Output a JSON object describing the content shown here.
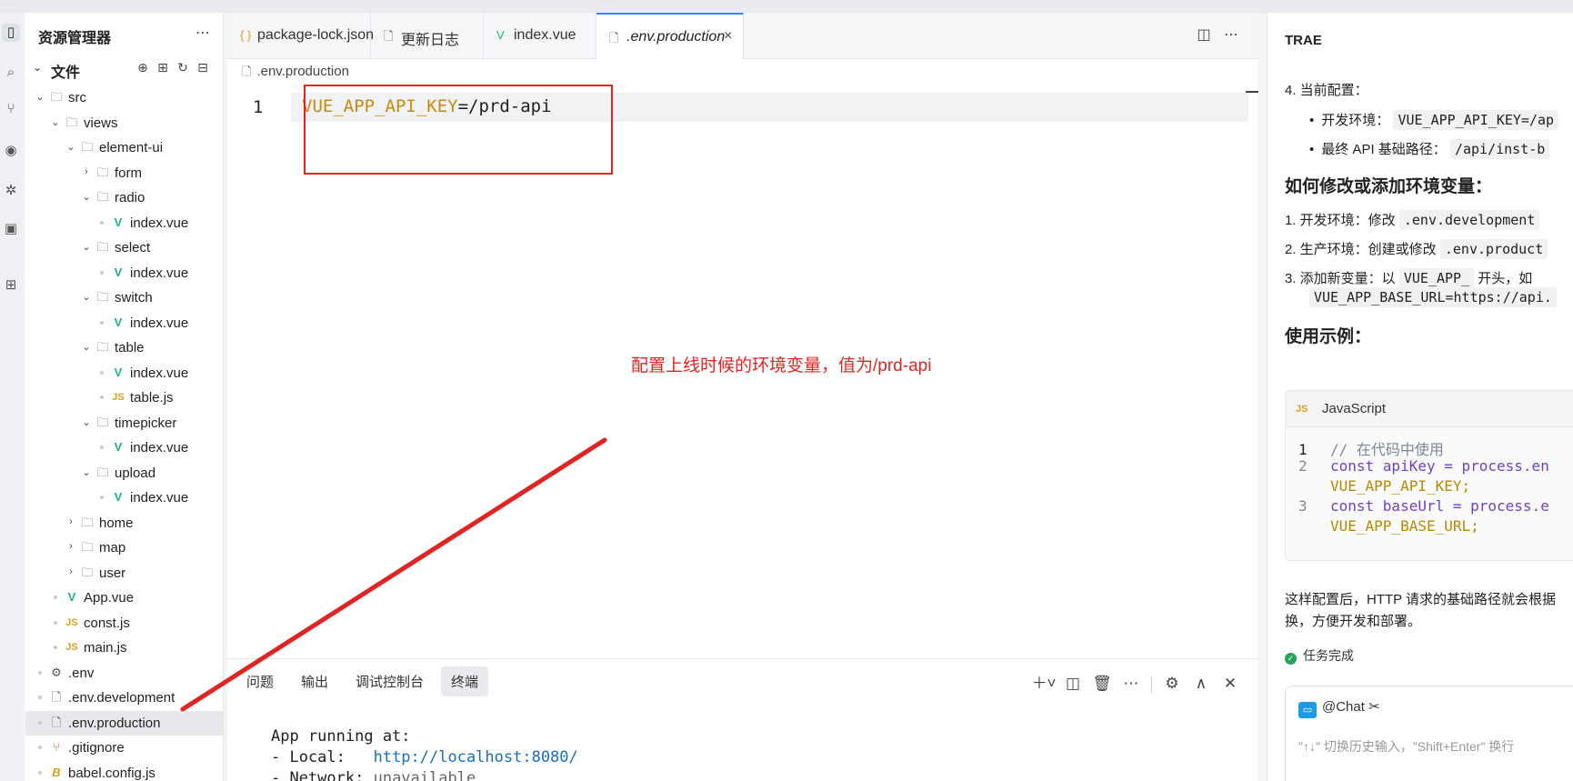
{
  "sidebar": {
    "title": "资源管理器",
    "section_label": "文件",
    "tree": [
      {
        "label": "src",
        "kind": "folder",
        "depth": 0,
        "expanded": true
      },
      {
        "label": "views",
        "kind": "folder",
        "depth": 1,
        "expanded": true
      },
      {
        "label": "element-ui",
        "kind": "folder",
        "depth": 2,
        "expanded": true
      },
      {
        "label": "form",
        "kind": "folder",
        "depth": 3,
        "expanded": false
      },
      {
        "label": "radio",
        "kind": "folder",
        "depth": 3,
        "expanded": true
      },
      {
        "label": "index.vue",
        "kind": "vue",
        "depth": 4
      },
      {
        "label": "select",
        "kind": "folder",
        "depth": 3,
        "expanded": true
      },
      {
        "label": "index.vue",
        "kind": "vue",
        "depth": 4
      },
      {
        "label": "switch",
        "kind": "folder",
        "depth": 3,
        "expanded": true
      },
      {
        "label": "index.vue",
        "kind": "vue",
        "depth": 4
      },
      {
        "label": "table",
        "kind": "folder",
        "depth": 3,
        "expanded": true
      },
      {
        "label": "index.vue",
        "kind": "vue",
        "depth": 4
      },
      {
        "label": "table.js",
        "kind": "js",
        "depth": 4
      },
      {
        "label": "timepicker",
        "kind": "folder",
        "depth": 3,
        "expanded": true
      },
      {
        "label": "index.vue",
        "kind": "vue",
        "depth": 4
      },
      {
        "label": "upload",
        "kind": "folder",
        "depth": 3,
        "expanded": true
      },
      {
        "label": "index.vue",
        "kind": "vue",
        "depth": 4
      },
      {
        "label": "home",
        "kind": "folder",
        "depth": 2,
        "expanded": false
      },
      {
        "label": "map",
        "kind": "folder",
        "depth": 2,
        "expanded": false
      },
      {
        "label": "user",
        "kind": "folder",
        "depth": 2,
        "expanded": false
      },
      {
        "label": "App.vue",
        "kind": "vue",
        "depth": 1
      },
      {
        "label": "const.js",
        "kind": "js",
        "depth": 1
      },
      {
        "label": "main.js",
        "kind": "js",
        "depth": 1
      },
      {
        "label": ".env",
        "kind": "gear",
        "depth": 0
      },
      {
        "label": ".env.development",
        "kind": "file",
        "depth": 0
      },
      {
        "label": ".env.production",
        "kind": "file",
        "depth": 0,
        "selected": true
      },
      {
        "label": ".gitignore",
        "kind": "git",
        "depth": 0
      },
      {
        "label": "babel.config.js",
        "kind": "babel",
        "depth": 0
      }
    ]
  },
  "tabs": [
    {
      "label": "package-lock.json",
      "icon": "{}"
    },
    {
      "label": "更新日志",
      "icon": "file"
    },
    {
      "label": "index.vue",
      "icon": "vue"
    },
    {
      "label": ".env.production",
      "icon": "file",
      "active": true
    }
  ],
  "breadcrumb": ".env.production",
  "editor": {
    "line_number": "1",
    "code_key": "VUE_APP_API_KEY",
    "code_eq": "=",
    "code_val": "/prd-api"
  },
  "annotation": {
    "text": "配置上线时候的环境变量，值为/prd-api",
    "color": "#e02424"
  },
  "panel": {
    "tabs": [
      "问题",
      "输出",
      "调试控制台",
      "终端"
    ],
    "active_tab": "终端",
    "terminal": {
      "line1": "App running at:",
      "line2_label": "- Local:   ",
      "line2_link": "http://localhost:8080/",
      "line3_label": "- Network: ",
      "line3_value": "unavailable"
    }
  },
  "chat": {
    "title": "TRAE",
    "item4": "4. 当前配置：",
    "dev_env_label": "开发环境：",
    "dev_env_code": "VUE_APP_API_KEY=/ap",
    "final_api_label": "最终 API 基础路径：",
    "final_api_code": "/api/inst-b",
    "h_modify": "如何修改或添加环境变量：",
    "m1_label": "1. 开发环境：修改",
    "m1_code": ".env.development",
    "m2_label": "2. 生产环境：创建或修改",
    "m2_code": ".env.product",
    "m3_label": "3. 添加新变量：以",
    "m3_code": "VUE_APP_",
    "m3_suffix": "开头，如",
    "m3_code2": "VUE_APP_BASE_URL=https://api.",
    "h_example": "使用示例：",
    "code_lang": "JavaScript",
    "code_lines": [
      {
        "n": "1",
        "text": "// 在代码中使用"
      },
      {
        "n": "2",
        "text": "const apiKey = process.en"
      },
      {
        "n": "",
        "text": "VUE_APP_API_KEY;"
      },
      {
        "n": "3",
        "text": "const baseUrl = process.e"
      },
      {
        "n": "",
        "text": "VUE_APP_BASE_URL;"
      }
    ],
    "summary_1": "这样配置后，HTTP 请求的基础路径就会根据",
    "summary_2": "换，方便开发和部署。",
    "task_done": "任务完成",
    "agent": "@Chat",
    "input_placeholder": "\"↑↓\" 切换历史输入，\"Shift+Enter\" 换行"
  }
}
